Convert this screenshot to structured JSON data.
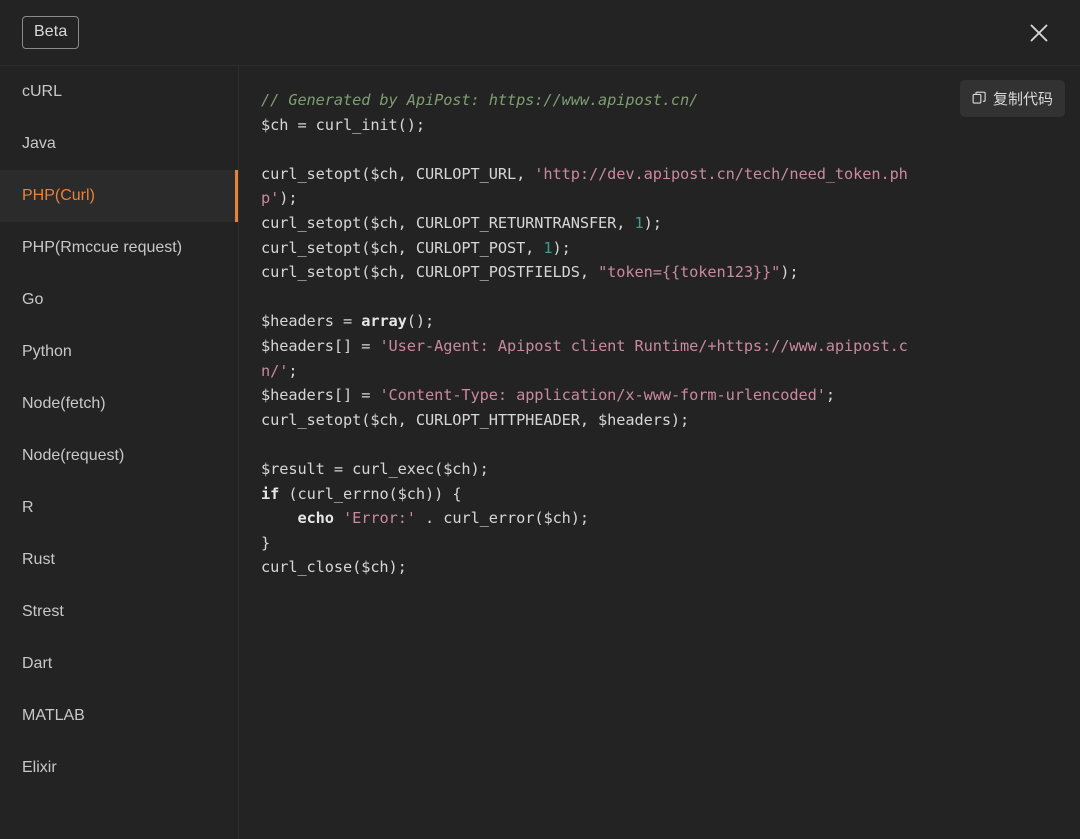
{
  "header": {
    "beta_label": "Beta",
    "close_icon": "close-icon"
  },
  "sidebar": {
    "items": [
      {
        "label": "cURL",
        "active": false
      },
      {
        "label": "Java",
        "active": false
      },
      {
        "label": "PHP(Curl)",
        "active": true
      },
      {
        "label": "PHP(Rmccue request)",
        "active": false
      },
      {
        "label": "Go",
        "active": false
      },
      {
        "label": "Python",
        "active": false
      },
      {
        "label": "Node(fetch)",
        "active": false
      },
      {
        "label": "Node(request)",
        "active": false
      },
      {
        "label": "R",
        "active": false
      },
      {
        "label": "Rust",
        "active": false
      },
      {
        "label": "Strest",
        "active": false
      },
      {
        "label": "Dart",
        "active": false
      },
      {
        "label": "MATLAB",
        "active": false
      },
      {
        "label": "Elixir",
        "active": false
      }
    ]
  },
  "code_pane": {
    "copy_button_label": "复制代码",
    "copy_icon": "copy-icon",
    "language": "PHP(Curl)",
    "code_lines": [
      "// Generated by ApiPost: https://www.apipost.cn/",
      "$ch = curl_init();",
      "",
      "curl_setopt($ch, CURLOPT_URL, 'http://dev.apipost.cn/tech/need_token.php');",
      "curl_setopt($ch, CURLOPT_RETURNTRANSFER, 1);",
      "curl_setopt($ch, CURLOPT_POST, 1);",
      "curl_setopt($ch, CURLOPT_POSTFIELDS, \"token={{token123}}\");",
      "",
      "$headers = array();",
      "$headers[] = 'User-Agent: Apipost client Runtime/+https://www.apipost.cn/';",
      "$headers[] = 'Content-Type: application/x-www-form-urlencoded';",
      "curl_setopt($ch, CURLOPT_HTTPHEADER, $headers);",
      "",
      "$result = curl_exec($ch);",
      "if (curl_errno($ch)) {",
      "    echo 'Error:' . curl_error($ch);",
      "}",
      "curl_close($ch);"
    ],
    "colors": {
      "comment": "#7e9e72",
      "string": "#c9899e",
      "number": "#3f9e8d",
      "keyword": "#e6e6e6",
      "default_text": "#d6d6d6",
      "background": "#232323",
      "accent": "#e8823a"
    }
  }
}
